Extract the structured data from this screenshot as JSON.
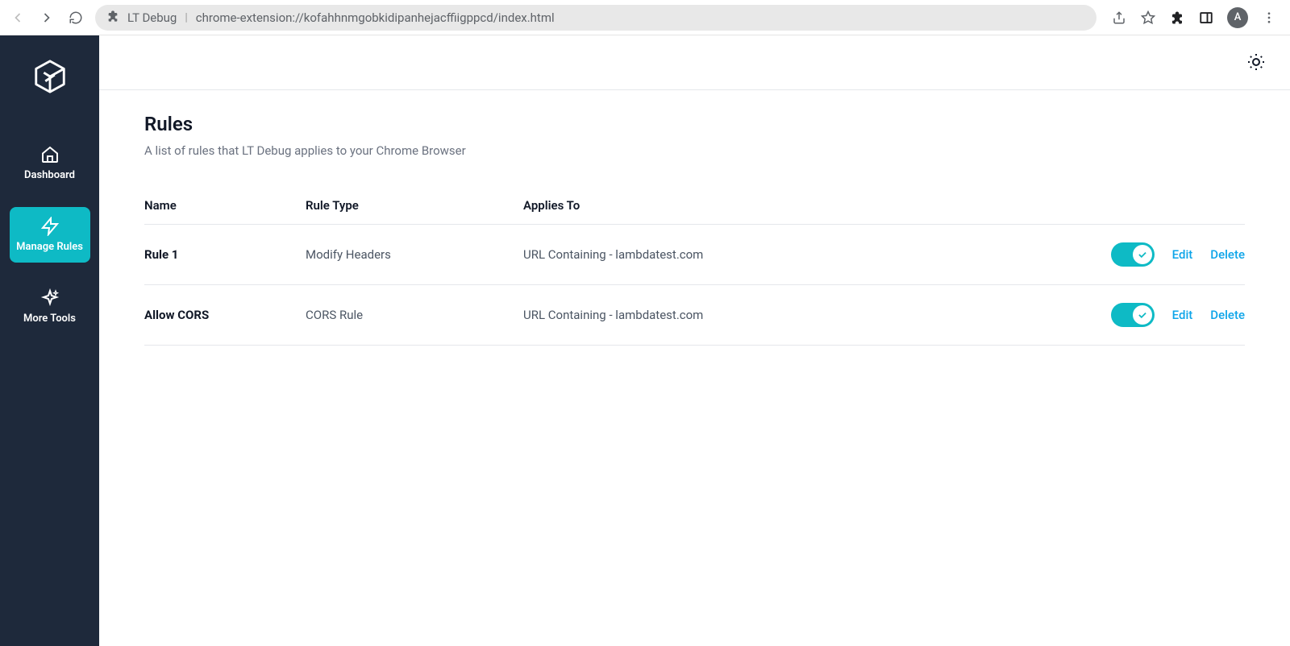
{
  "browser": {
    "extension_name": "LT Debug",
    "url": "chrome-extension://kofahhnmgobkidipanhejacffiigppcd/index.html",
    "avatar_initial": "A"
  },
  "sidebar": {
    "items": [
      {
        "label": "Dashboard"
      },
      {
        "label": "Manage Rules"
      },
      {
        "label": "More Tools"
      }
    ]
  },
  "page": {
    "title": "Rules",
    "description": "A list of rules that LT Debug applies to your Chrome Browser"
  },
  "table": {
    "headers": {
      "name": "Name",
      "type": "Rule Type",
      "applies": "Applies To"
    },
    "rows": [
      {
        "name": "Rule 1",
        "type": "Modify Headers",
        "applies": "URL Containing - lambdatest.com",
        "edit_label": "Edit",
        "delete_label": "Delete"
      },
      {
        "name": "Allow CORS",
        "type": "CORS Rule",
        "applies": "URL Containing - lambdatest.com",
        "edit_label": "Edit",
        "delete_label": "Delete"
      }
    ]
  }
}
